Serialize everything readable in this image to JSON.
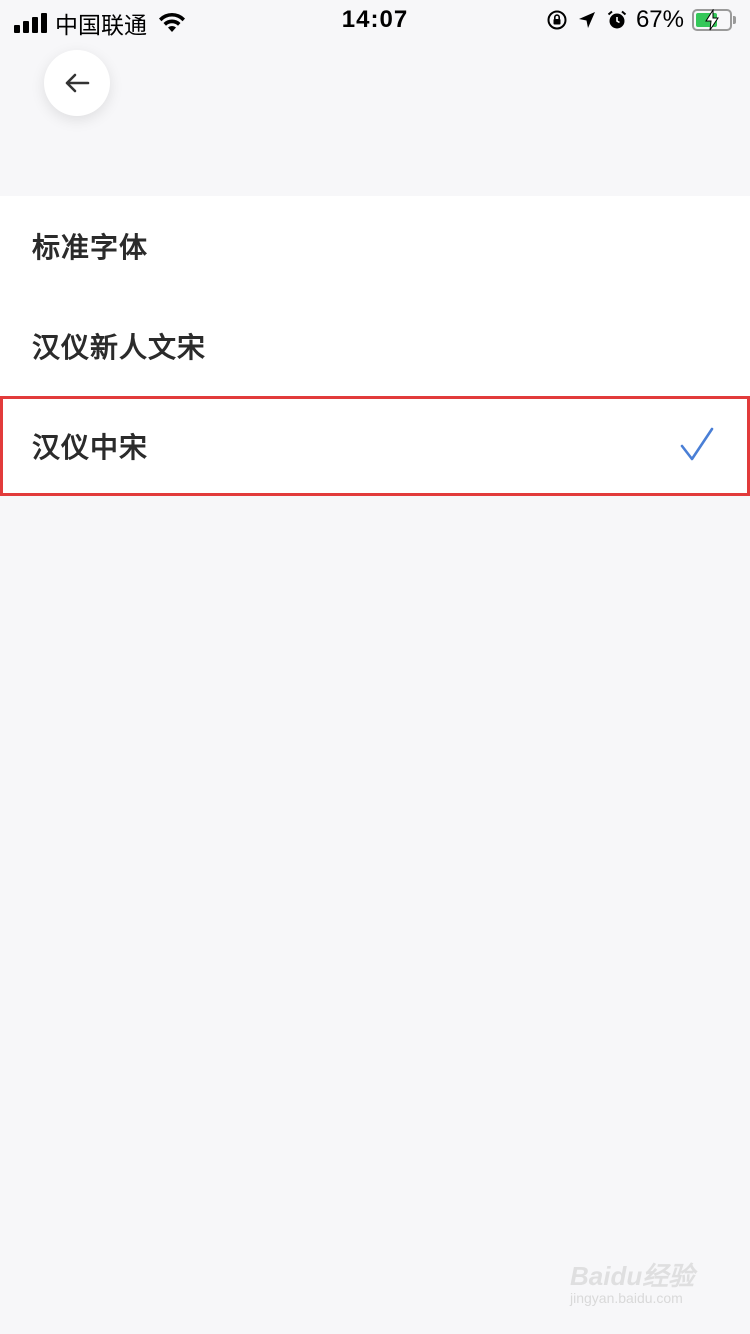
{
  "status_bar": {
    "carrier": "中国联通",
    "time": "14:07",
    "battery_percent": "67%",
    "battery_level": 0.67,
    "signal_bars": 4
  },
  "header": {
    "back_icon": "arrow-left-icon"
  },
  "font_list": {
    "items": [
      {
        "label": "标准字体",
        "selected": false
      },
      {
        "label": "汉仪新人文宋",
        "selected": false
      },
      {
        "label": "汉仪中宋",
        "selected": true
      }
    ],
    "selected_icon": "checkmark-icon"
  },
  "colors": {
    "accent": "#4a7fd6",
    "highlight_border": "#e23b3b",
    "background": "#f7f7f9"
  },
  "watermark": {
    "brand": "Baidu经验",
    "url": "jingyan.baidu.com"
  }
}
